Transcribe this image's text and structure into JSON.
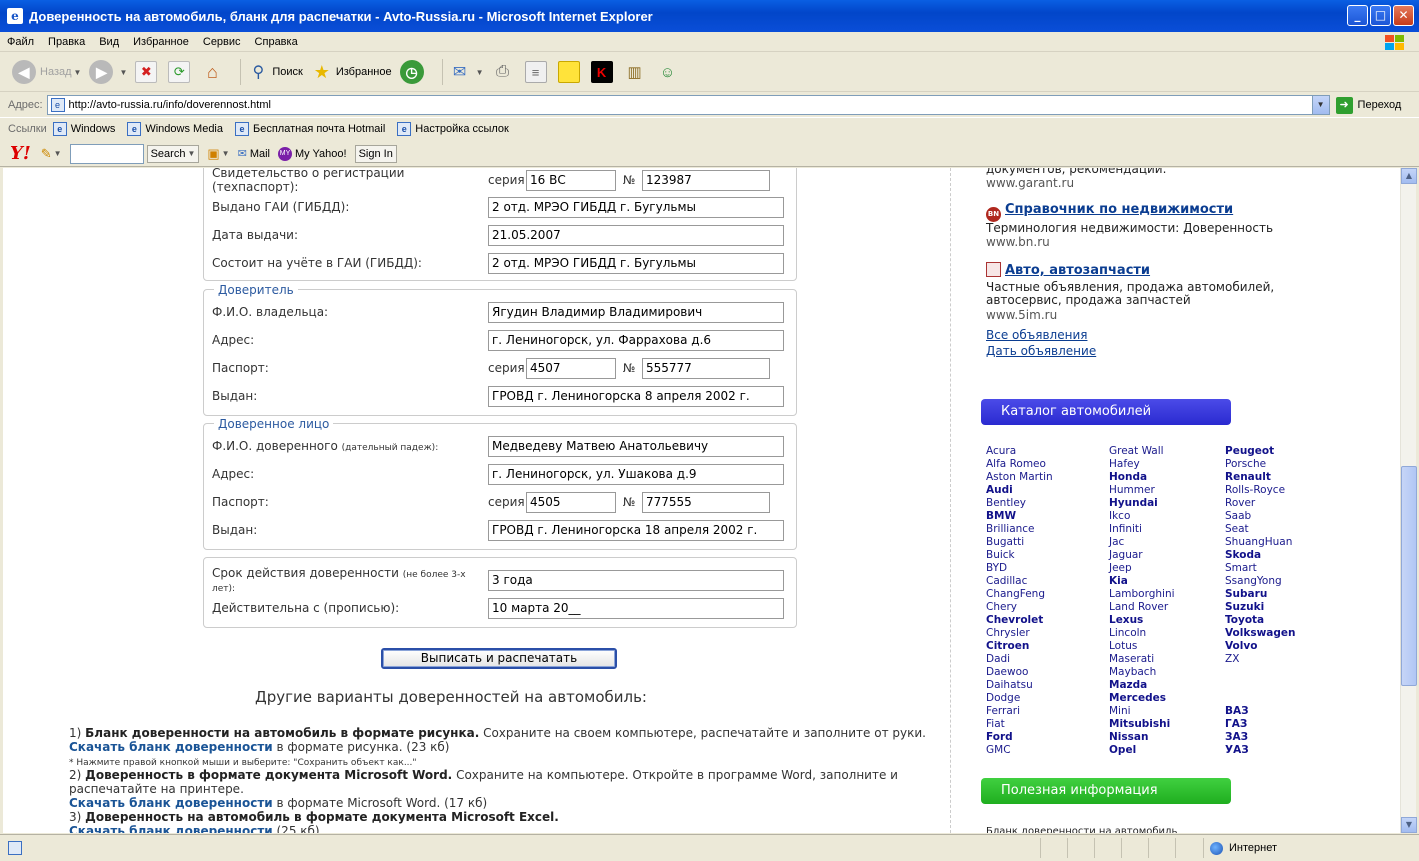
{
  "window": {
    "title": "Доверенность на автомобиль, бланк для распечатки - Avto-Russia.ru - Microsoft Internet Explorer"
  },
  "menu": [
    "Файл",
    "Правка",
    "Вид",
    "Избранное",
    "Сервис",
    "Справка"
  ],
  "toolbar": {
    "back_label": "Назад",
    "search_label": "Поиск",
    "favorites_label": "Избранное"
  },
  "address": {
    "label": "Адрес:",
    "url": "http://avto-russia.ru/info/doverennost.html",
    "go_label": "Переход"
  },
  "links": {
    "label": "Ссылки",
    "items": [
      "Windows",
      "Windows Media",
      "Бесплатная почта Hotmail",
      "Настройка ссылок"
    ]
  },
  "yahoo": {
    "search_label": "Search",
    "mail_label": "Mail",
    "myyahoo_label": "My Yahoo!",
    "signin_label": "Sign In"
  },
  "form": {
    "vehicle": {
      "reg_label": "Свидетельство о регистрации (техпаспорт):",
      "series_label": "серия",
      "number_label": "№",
      "reg_series": "16 ВС",
      "reg_number": "123987",
      "issued_label": "Выдано ГАИ (ГИБДД):",
      "issued_value": "2 отд. МРЭО ГИБДД г. Бугульмы",
      "date_label": "Дата выдачи:",
      "date_value": "21.05.2007",
      "registered_label": "Состоит на учёте в ГАИ (ГИБДД):",
      "registered_value": "2 отд. МРЭО ГИБДД г. Бугульмы"
    },
    "principal": {
      "legend": "Доверитель",
      "name_label": "Ф.И.О. владельца:",
      "name_value": "Ягудин Владимир Владимирович",
      "address_label": "Адрес:",
      "address_value": "г. Лениногорск, ул. Фаррахова д.6",
      "passport_label": "Паспорт:",
      "series_label": "серия",
      "passport_series": "4507",
      "number_label": "№",
      "passport_number": "555777",
      "issued_label": "Выдан:",
      "issued_value": "ГРОВД г. Лениногорска 8 апреля 2002 г."
    },
    "attorney": {
      "legend": "Доверенное лицо",
      "name_label": "Ф.И.О. доверенного",
      "name_hint": "(дательный падеж):",
      "name_value": "Медведеву Матвею Анатольевичу",
      "address_label": "Адрес:",
      "address_value": "г. Лениногорск, ул. Ушакова д.9",
      "passport_label": "Паспорт:",
      "series_label": "серия",
      "passport_series": "4505",
      "number_label": "№",
      "passport_number": "777555",
      "issued_label": "Выдан:",
      "issued_value": "ГРОВД г. Лениногорска 18 апреля 2002 г."
    },
    "validity": {
      "term_label": "Срок действия доверенности",
      "term_hint": "(не более 3-х лет):",
      "term_value": "3 года",
      "from_label": "Действительна с (прописью):",
      "from_value": "10 марта 20__"
    },
    "print_button": "Выписать и распечатать"
  },
  "other": {
    "heading": "Другие варианты доверенностей на автомобиль:",
    "item1_num": "1)",
    "item1_bold": "Бланк доверенности на автомобиль в формате рисунка.",
    "item1_text": " Сохраните на своем компьютере, распечатайте и заполните от руки.",
    "item1_link": "Скачать бланк доверенности",
    "item1_fmt": " в формате рисунка. (23 кб)",
    "item1_note": "* Нажмите правой кнопкой мыши и выберите: \"Сохранить объект как...\"",
    "item2_num": "2)",
    "item2_bold": "Доверенность в формате документа Microsoft Word.",
    "item2_text": " Сохраните на компьютере. Откройте в программе Word, заполните и распечатайте на принтере.",
    "item2_link": "Скачать бланк доверенности",
    "item2_fmt": " в формате Microsoft Word. (17 кб)",
    "item3_num": "3)",
    "item3_bold": "Доверенность на автомобиль в формате документа Microsoft Excel.",
    "item3_link": "Скачать бланк доверенности",
    "item3_fmt": " (25 кб)"
  },
  "sidebar": {
    "garant_text": "документов, рекомендации.",
    "garant_www": "www.garant.ru",
    "realty_title": "Справочник по недвижимости",
    "realty_icon_text": "BN",
    "realty_text": "Терминология недвижимости: Доверенность",
    "realty_www": "www.bn.ru",
    "auto_title": "Авто, автозапчасти",
    "auto_text": "Частные объявления, продажа автомобилей, автосервис, продажа запчастей",
    "auto_www": "www.5im.ru",
    "all_ads": "Все объявления",
    "post_ad": "Дать объявление",
    "catalog_title": "Каталог автомобилей",
    "useful_title": "Полезная информация",
    "bottom_text": "Бланк доверенности на автомобиль"
  },
  "brands": {
    "col1": [
      "Acura",
      "Alfa Romeo",
      "Aston Martin",
      "Audi",
      "Bentley",
      "BMW",
      "Brilliance",
      "Bugatti",
      "Buick",
      "BYD",
      "Cadillac",
      "ChangFeng",
      "Chery",
      "Chevrolet",
      "Chrysler",
      "Citroen",
      "Dadi",
      "Daewoo",
      "Daihatsu",
      "Dodge",
      "Ferrari",
      "Fiat",
      "Ford",
      "GMC"
    ],
    "col1_bold": [
      "Audi",
      "BMW",
      "Chevrolet",
      "Citroen",
      "Ford"
    ],
    "col2": [
      "Great Wall",
      "Hafey",
      "Honda",
      "Hummer",
      "Hyundai",
      "Ikco",
      "Infiniti",
      "Jac",
      "Jaguar",
      "Jeep",
      "Kia",
      "Lamborghini",
      "Land Rover",
      "Lexus",
      "Lincoln",
      "Lotus",
      "Maserati",
      "Maybach",
      "Mazda",
      "Mercedes",
      "Mini",
      "Mitsubishi",
      "Nissan",
      "Opel"
    ],
    "col2_bold": [
      "Honda",
      "Hyundai",
      "Kia",
      "Lexus",
      "Mazda",
      "Mercedes",
      "Mitsubishi",
      "Nissan",
      "Opel"
    ],
    "col3": [
      "Peugeot",
      "Porsche",
      "Renault",
      "Rolls-Royce",
      "Rover",
      "Saab",
      "Seat",
      "ShuangHuan",
      "Skoda",
      "Smart",
      "SsangYong",
      "Subaru",
      "Suzuki",
      "Toyota",
      "Volkswagen",
      "Volvo",
      "ZX",
      "",
      "",
      "",
      "ВАЗ",
      "ГАЗ",
      "ЗАЗ",
      "УАЗ"
    ],
    "col3_bold": [
      "Peugeot",
      "Renault",
      "Skoda",
      "Subaru",
      "Suzuki",
      "Toyota",
      "Volkswagen",
      "Volvo",
      "ВАЗ",
      "ГАЗ",
      "ЗАЗ",
      "УАЗ"
    ]
  },
  "status": {
    "zone": "Интернет"
  },
  "colors": {
    "titlebar": "#0a4ed8",
    "link": "#0b3d91",
    "catalog_bar": "#2a2ad0",
    "useful_bar": "#1fae1f"
  }
}
